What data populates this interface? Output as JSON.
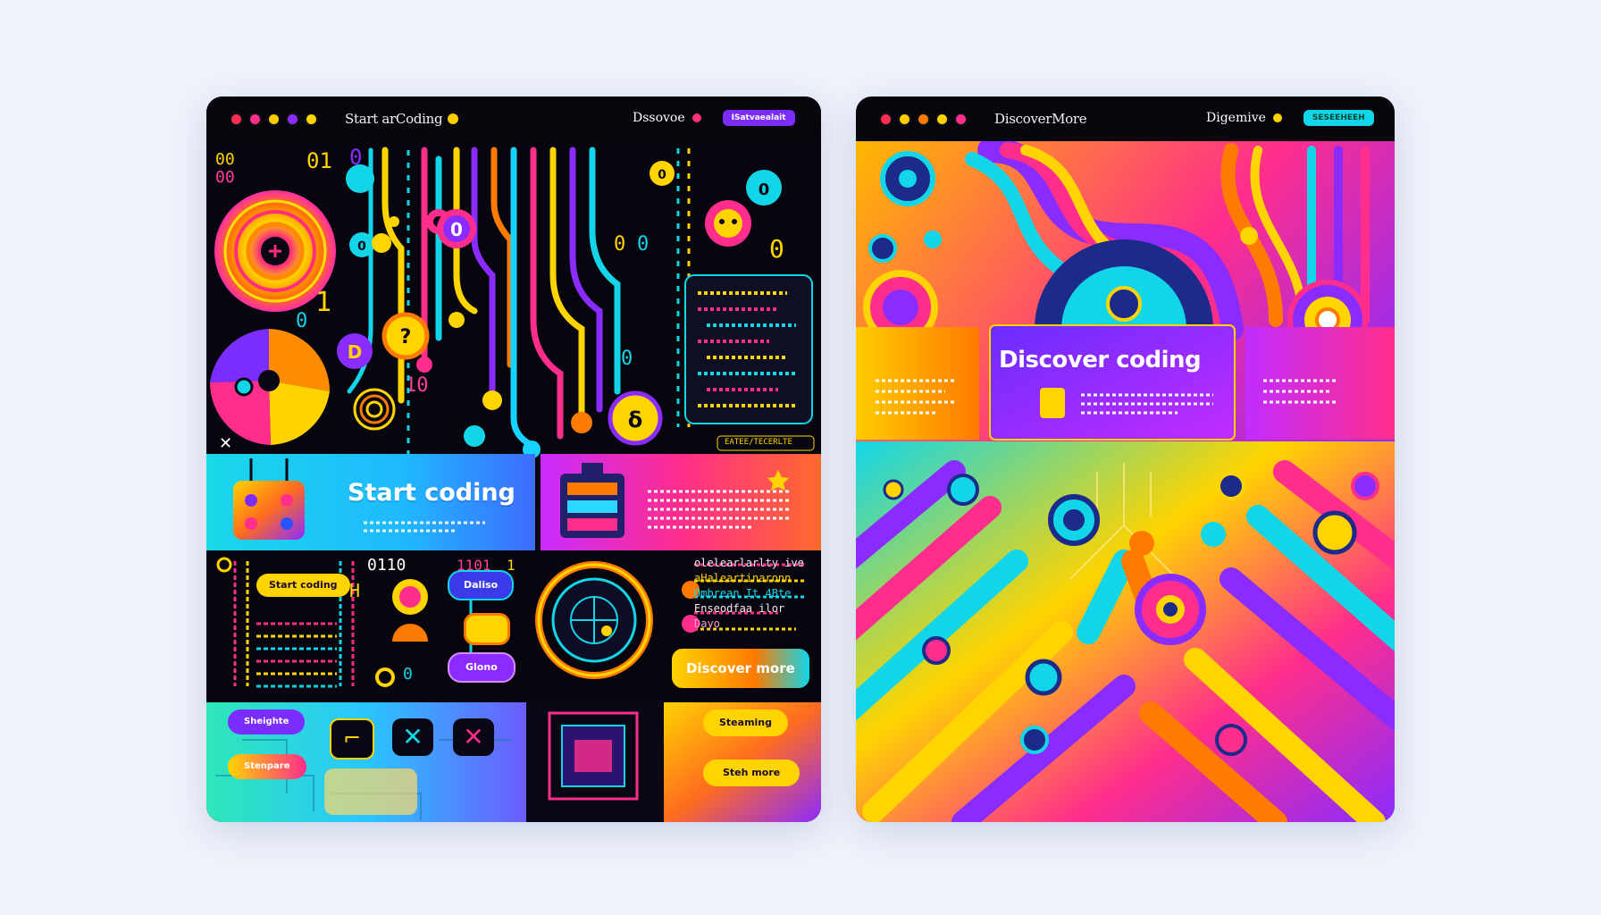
{
  "left": {
    "brand": "Start arCoding",
    "nav_link": "Dssovoe",
    "nav_pill": "ISatvaealait",
    "hero_text": "Start coding",
    "btn_start_coding": "Start coding",
    "btn_daliso": "Daliso",
    "btn_glono": "Glono",
    "btn_discover_more": "Discover more",
    "btn_steaming": "Steaming",
    "btn_steh_more": "Steh more",
    "btn_sheighte": "Sheighte",
    "btn_stenpare": "Stenpare",
    "terminal_tag": "EATEE/TECERLTE",
    "code_lines": [
      "olelearlarlty ive",
      "aHaleartinaronn",
      "Ombrean It 4Bte",
      "Enseodfaa ilor",
      "Dayo"
    ],
    "digits": [
      "00",
      "01",
      "0",
      "10",
      "1",
      "0110",
      "1101",
      "0"
    ]
  },
  "right": {
    "brand": "DiscoverMore",
    "nav_link": "Digemive",
    "nav_pill": "SESEEHEEH",
    "card_title": "Discover coding"
  },
  "colors": {
    "page_bg": "#eef2fb",
    "panel_bg": "#0a0714",
    "yellow": "#ffd400",
    "magenta": "#ff1f8e",
    "purple": "#7a2cff",
    "cyan": "#12d6e8",
    "orange": "#ff7a00"
  },
  "icons": [
    "window-dot-icon",
    "circuit-icon",
    "puzzle-icon",
    "play-icon",
    "close-icon",
    "star-icon"
  ]
}
